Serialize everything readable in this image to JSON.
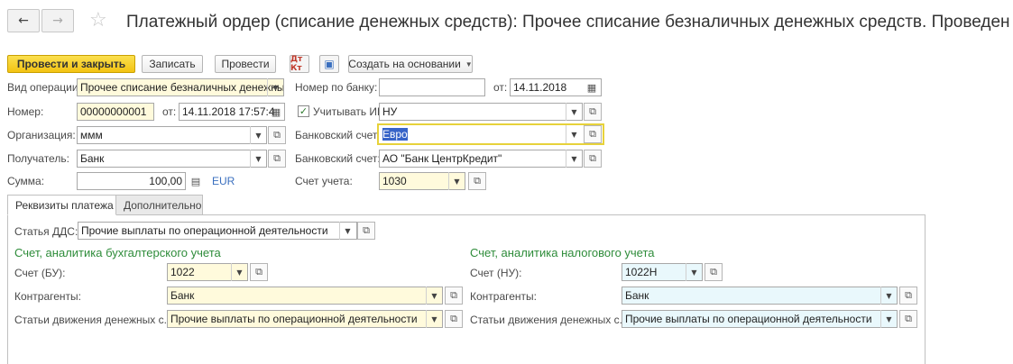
{
  "titlebar": {
    "back_icon": "←",
    "forward_icon": "→",
    "star_icon": "☆",
    "title": "Платежный ордер (списание денежных средств): Прочее списание безналичных денежных средств. Проведен"
  },
  "toolbar": {
    "post_close_label": "Провести и закрыть",
    "save_label": "Записать",
    "post_label": "Провести",
    "dt_kt_label": "Дт Кт",
    "create_based_label": "Создать на основании"
  },
  "header": {
    "operation_type": {
      "label": "Вид операции:",
      "value": "Прочее списание безналичных денежных средств"
    },
    "bank_number": {
      "label": "Номер по банку:",
      "value": ""
    },
    "bank_date": {
      "label": "от:",
      "value": "14.11.2018"
    },
    "number": {
      "label": "Номер:",
      "value": "00000000001"
    },
    "number_date": {
      "label": "от:",
      "value": "14.11.2018 17:57:4"
    },
    "ipn": {
      "label": "Учитывать ИПН",
      "checked": true,
      "value": "НУ"
    },
    "organization": {
      "label": "Организация:",
      "value": "ммм"
    },
    "bank_account_org": {
      "label": "Банковский счет:",
      "value": "Евро"
    },
    "recipient": {
      "label": "Получатель:",
      "value": "Банк"
    },
    "bank_account_recipient": {
      "label": "Банковский счет:",
      "value": "АО \"Банк ЦентрКредит\""
    },
    "amount": {
      "label": "Сумма:",
      "value": "100,00",
      "currency": "EUR"
    },
    "account": {
      "label": "Счет учета:",
      "value": "1030"
    }
  },
  "tabs": [
    {
      "label": "Реквизиты платежа",
      "active": true
    },
    {
      "label": "Дополнительно",
      "active": false
    }
  ],
  "payment": {
    "dds": {
      "label": "Статья ДДС:",
      "value": "Прочие выплаты по операционной деятельности"
    },
    "bu": {
      "title": "Счет, аналитика бухгалтерского учета",
      "account_label": "Счет (БУ):",
      "account_value": "1022",
      "contractor_label": "Контрагенты:",
      "contractor_value": "Банк",
      "cashflow_label": "Статьи движения денежных с...",
      "cashflow_value": "Прочие выплаты по операционной деятельности"
    },
    "nu": {
      "title": "Счет, аналитика налогового учета",
      "account_label": "Счет (НУ):",
      "account_value": "1022Н",
      "contractor_label": "Контрагенты:",
      "contractor_value": "Банк",
      "cashflow_label": "Статьи движения денежных с...",
      "cashflow_value": "Прочие выплаты по операционной деятельности"
    }
  },
  "icons": {
    "dropdown": "▼",
    "open": "⧉",
    "calendar": "▦",
    "calc": "▤",
    "check": "✓"
  },
  "colors": {
    "primary_button": "#f3c312",
    "section_title": "#2e8c3a",
    "yellow_field": "#fffadc",
    "blue_field": "#e9f8fc",
    "selection": "#3764c8"
  }
}
